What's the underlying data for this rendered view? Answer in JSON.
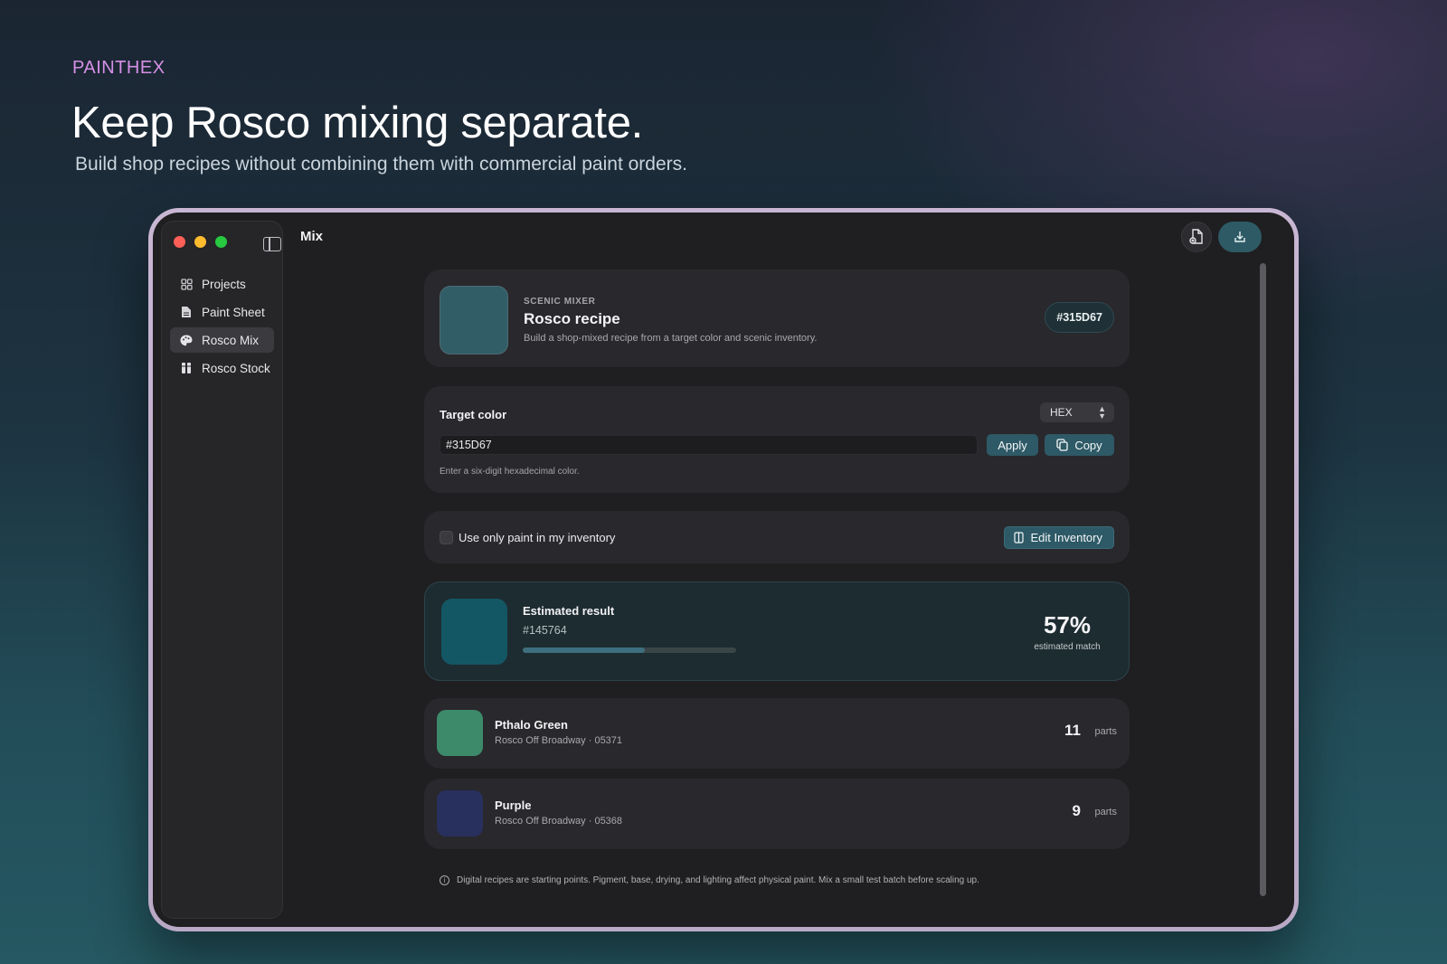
{
  "hero": {
    "brand": "PAINTHEX",
    "headline": "Keep Rosco mixing separate.",
    "subline": "Build shop recipes without combining them with commercial paint orders."
  },
  "window": {
    "title": "Mix"
  },
  "sidebar": {
    "items": [
      {
        "label": "Projects",
        "icon": "grid-icon",
        "active": false
      },
      {
        "label": "Paint Sheet",
        "icon": "document-icon",
        "active": false
      },
      {
        "label": "Rosco Mix",
        "icon": "palette-icon",
        "active": true
      },
      {
        "label": "Rosco Stock",
        "icon": "paint-cans-icon",
        "active": false
      }
    ]
  },
  "header": {
    "eyebrow": "SCENIC MIXER",
    "title": "Rosco recipe",
    "description": "Build a shop-mixed recipe from a target color and scenic inventory.",
    "hex": "#315D67",
    "swatch_color": "#315D67"
  },
  "target": {
    "label": "Target color",
    "format": "HEX",
    "value": "#315D67",
    "apply_label": "Apply",
    "copy_label": "Copy",
    "hint": "Enter a six-digit hexadecimal color."
  },
  "inventory": {
    "checkbox_label": "Use only paint in my inventory",
    "checked": false,
    "edit_label": "Edit Inventory"
  },
  "result": {
    "title": "Estimated result",
    "hex": "#145764",
    "swatch_color": "#145764",
    "match_percent": "57%",
    "match_value": 0.57,
    "match_label": "estimated match"
  },
  "paints": [
    {
      "name": "Pthalo Green",
      "source": "Rosco Off Broadway · 05371",
      "parts": "11",
      "unit": "parts",
      "color": "#3d8a6b"
    },
    {
      "name": "Purple",
      "source": "Rosco Off Broadway · 05368",
      "parts": "9",
      "unit": "parts",
      "color": "#28305e"
    }
  ],
  "disclaimer": "Digital recipes are starting points. Pigment, base, drying, and lighting affect physical paint. Mix a small test batch before scaling up.",
  "colors": {
    "accent": "#2e5966",
    "brand": "#d690e6"
  }
}
